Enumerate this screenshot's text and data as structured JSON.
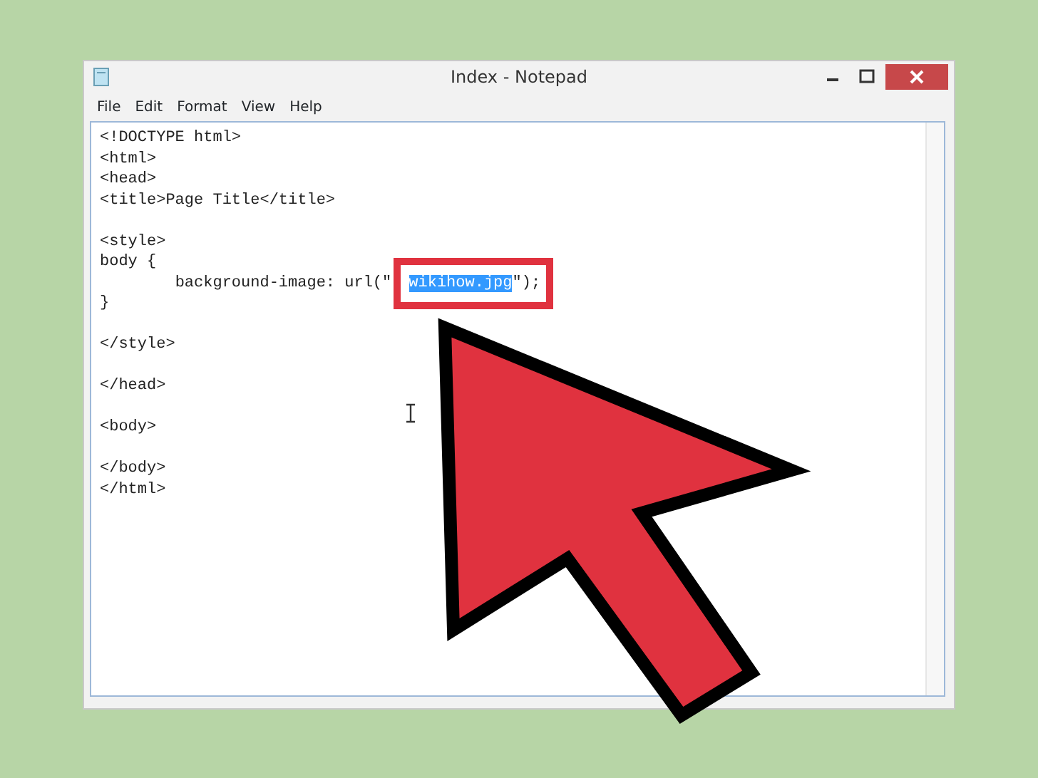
{
  "window": {
    "title": "Index - Notepad"
  },
  "menu": [
    "File",
    "Edit",
    "Format",
    "View",
    "Help"
  ],
  "editor": {
    "blocks": [
      [
        {
          "text": "<!DOCTYPE html>"
        },
        {
          "text": "<html>"
        },
        {
          "text": "<head>"
        },
        {
          "text": "<title>Page Title</title>"
        }
      ],
      [
        {
          "text": "<style>"
        },
        {
          "text": "body {"
        },
        {
          "text": "\tbackground-image: url(\"",
          "selected_text": "wikihow.jpg",
          "text_after": "\");",
          "framed": true
        },
        {
          "text": "}"
        }
      ],
      [
        {
          "text": "</style>"
        }
      ],
      [
        {
          "text": "</head>"
        }
      ],
      [
        {
          "text": "<body>"
        }
      ],
      [
        {
          "text": "</body>"
        },
        {
          "text": "</html>"
        }
      ]
    ]
  }
}
